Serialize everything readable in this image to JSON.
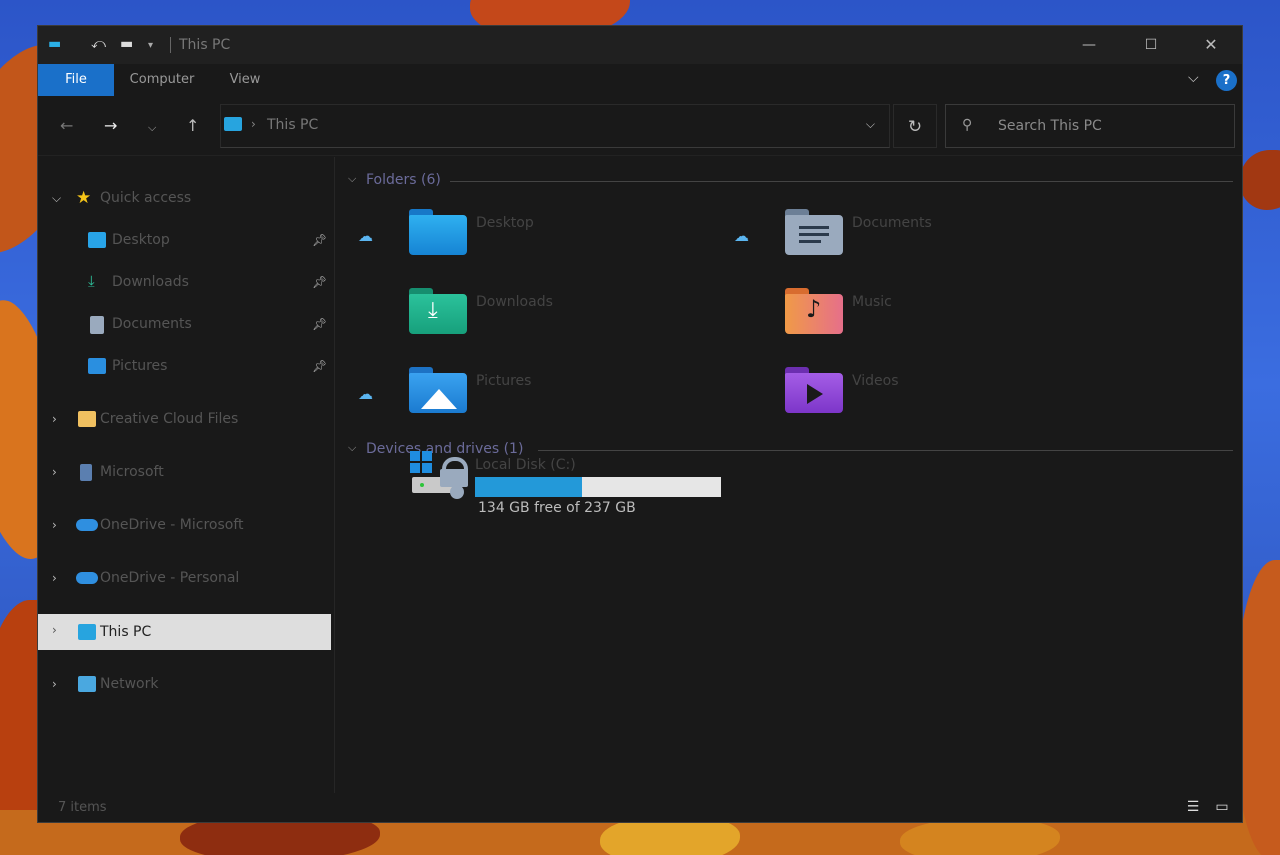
{
  "window": {
    "title": "This PC",
    "controls": {
      "minimize": "—",
      "maximize": "☐",
      "close": "✕"
    }
  },
  "ribbon": {
    "tabs": [
      "File",
      "Computer",
      "View"
    ],
    "help": "?"
  },
  "navigation": {
    "address_path": "This PC",
    "search_placeholder": "Search This PC"
  },
  "sidebar": {
    "quick_access": {
      "label": "Quick access",
      "items": [
        {
          "label": "Desktop",
          "icon": "desktop-icon",
          "pinned": true
        },
        {
          "label": "Downloads",
          "icon": "download-icon",
          "pinned": true
        },
        {
          "label": "Documents",
          "icon": "document-icon",
          "pinned": true
        },
        {
          "label": "Pictures",
          "icon": "pictures-icon",
          "pinned": true
        }
      ]
    },
    "roots": [
      {
        "label": "Creative Cloud Files",
        "icon": "creative-cloud-folder-icon"
      },
      {
        "label": "Microsoft",
        "icon": "building-icon"
      },
      {
        "label": "OneDrive - Microsoft",
        "icon": "onedrive-cloud-icon"
      },
      {
        "label": "OneDrive - Personal",
        "icon": "onedrive-cloud-icon"
      },
      {
        "label": "This PC",
        "icon": "computer-icon",
        "selected": true
      },
      {
        "label": "Network",
        "icon": "network-icon"
      }
    ]
  },
  "main": {
    "folders_group": "Folders (6)",
    "folders": [
      {
        "name": "Desktop",
        "cloud": true,
        "color": "#1e9be8"
      },
      {
        "name": "Documents",
        "cloud": true,
        "color": "#8ea1b8"
      },
      {
        "name": "Downloads",
        "cloud": false,
        "color": "#1fb08c"
      },
      {
        "name": "Music",
        "cloud": false,
        "color": "#ef8a58"
      },
      {
        "name": "Pictures",
        "cloud": true,
        "color": "#2a8fe0"
      },
      {
        "name": "Videos",
        "cloud": false,
        "color": "#9145d6"
      }
    ],
    "drives_group": "Devices and drives (1)",
    "drives": [
      {
        "name": "Local Disk (C:)",
        "free_text": "134 GB free of 237 GB",
        "used_fraction": 0.435
      }
    ]
  },
  "status": {
    "item_count": "7 items"
  },
  "colors": {
    "accent": "#1a70c9",
    "window_bg": "#191919",
    "selected_row": "#dedede",
    "drive_bar": "#2399d9"
  }
}
